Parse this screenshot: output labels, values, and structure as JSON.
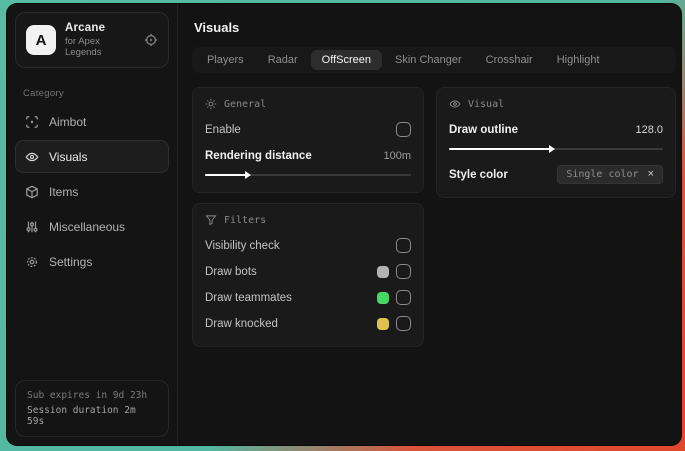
{
  "backdrop": {
    "teal": "#52b7a0",
    "red": "#e0482c"
  },
  "sidebar": {
    "brand": {
      "initial": "A",
      "name": "Arcane",
      "subtitle": "for Apex Legends"
    },
    "category_label": "Category",
    "items": [
      {
        "label": "Aimbot",
        "icon": "crosshair-icon",
        "selected": false
      },
      {
        "label": "Visuals",
        "icon": "eye-icon",
        "selected": true
      },
      {
        "label": "Items",
        "icon": "package-icon",
        "selected": false
      },
      {
        "label": "Miscellaneous",
        "icon": "sliders-icon",
        "selected": false
      },
      {
        "label": "Settings",
        "icon": "gear-icon",
        "selected": false
      }
    ],
    "session": {
      "expires": "Sub expires in 9d 23h",
      "duration": "Session duration 2m 59s"
    }
  },
  "main": {
    "title": "Visuals",
    "tabs": [
      {
        "label": "Players",
        "selected": false
      },
      {
        "label": "Radar",
        "selected": false
      },
      {
        "label": "OffScreen",
        "selected": true
      },
      {
        "label": "Skin Changer",
        "selected": false
      },
      {
        "label": "Crosshair",
        "selected": false
      },
      {
        "label": "Highlight",
        "selected": false
      }
    ],
    "panels": {
      "general": {
        "title": "General",
        "enable_label": "Enable",
        "enable_checked": false,
        "rendering": {
          "label": "Rendering distance",
          "value": "100m",
          "fill": "20%"
        }
      },
      "filters": {
        "title": "Filters",
        "rows": [
          {
            "label": "Visibility check",
            "swatch": null,
            "checked": false
          },
          {
            "label": "Draw bots",
            "swatch": "#b3b3b3",
            "checked": false
          },
          {
            "label": "Draw teammates",
            "swatch": "#46d764",
            "checked": false
          },
          {
            "label": "Draw knocked",
            "swatch": "#e0c14f",
            "checked": false
          }
        ]
      },
      "visual": {
        "title": "Visual",
        "outline": {
          "label": "Draw outline",
          "value": "128.0",
          "fill": "47%"
        },
        "style_color": {
          "label": "Style color",
          "value": "Single color",
          "clear": "×"
        }
      }
    }
  }
}
